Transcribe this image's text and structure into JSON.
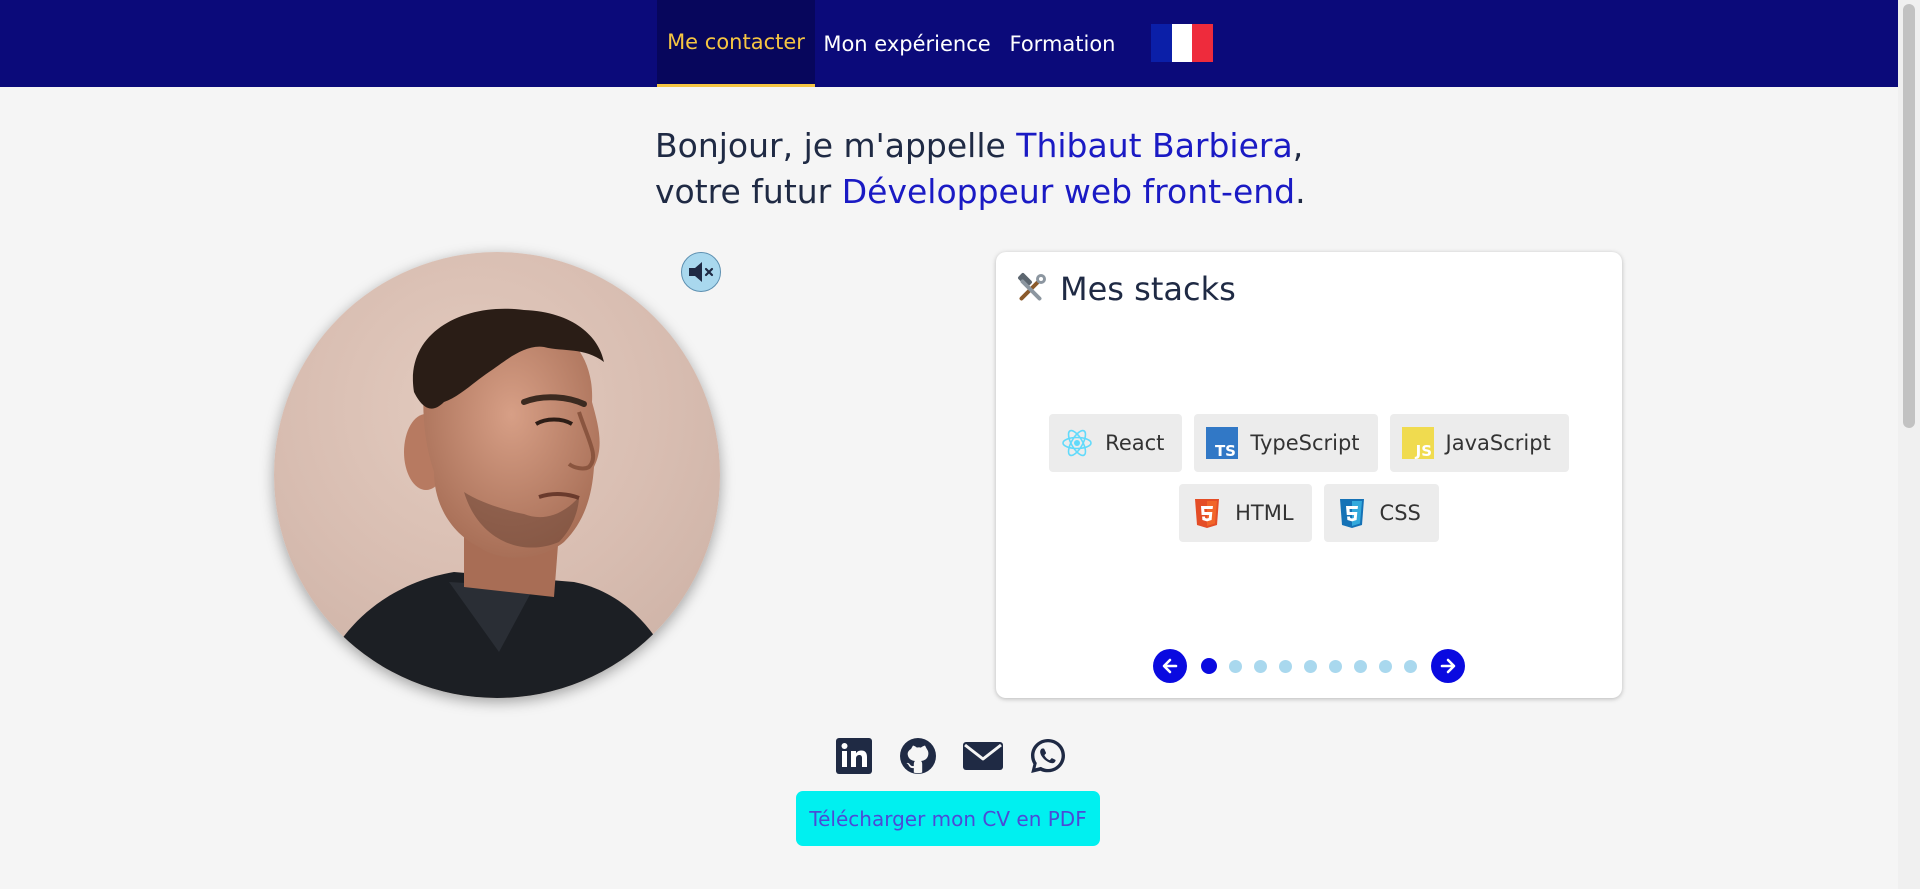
{
  "nav": {
    "items": [
      {
        "label": "Me contacter",
        "active": true
      },
      {
        "label": "Mon expérience",
        "active": false
      },
      {
        "label": "Formation",
        "active": false
      }
    ],
    "language_flag": "france-flag-icon"
  },
  "headline": {
    "line1_prefix": "Bonjour, je m'appelle ",
    "name": "Thibaut Barbiera",
    "line1_suffix": ",",
    "line2_prefix": "votre futur ",
    "role": "Développeur web front-end",
    "line2_suffix": "."
  },
  "portrait": {
    "audio_icon": "speaker-muted-icon"
  },
  "stacks": {
    "title": "Mes stacks",
    "title_icon": "hammer-wrench-icon",
    "items": [
      {
        "label": "React",
        "icon": "react-icon"
      },
      {
        "label": "TypeScript",
        "icon": "typescript-icon"
      },
      {
        "label": "JavaScript",
        "icon": "javascript-icon"
      },
      {
        "label": "HTML",
        "icon": "html5-icon"
      },
      {
        "label": "CSS",
        "icon": "css3-icon"
      }
    ],
    "pager": {
      "total_dots": 9,
      "active_index": 0
    }
  },
  "social": [
    "linkedin-icon",
    "github-icon",
    "mail-icon",
    "whatsapp-icon"
  ],
  "cv_button": "Télécharger mon CV en PDF",
  "colors": {
    "nav_bg": "#0b0a7a",
    "nav_active": "#f5c542",
    "accent": "#1a1ac4",
    "cv_button_bg": "#00f0f0",
    "pager_blue": "#0a0ae0"
  }
}
